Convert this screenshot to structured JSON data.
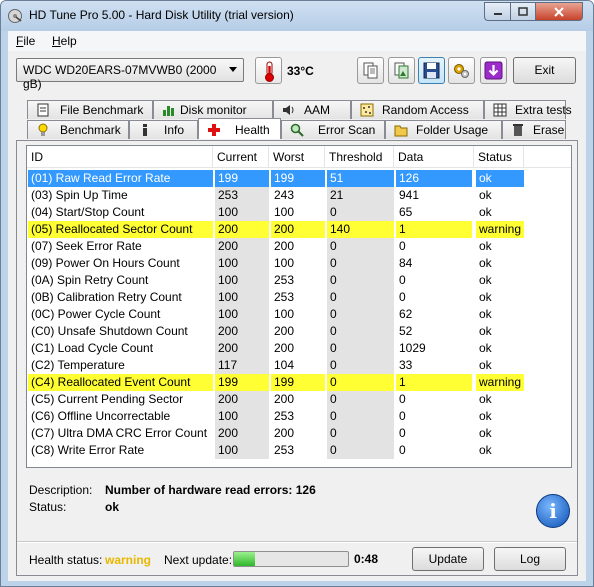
{
  "window": {
    "title": "HD Tune Pro 5.00 - Hard Disk Utility (trial version)"
  },
  "menu": {
    "file_u": "F",
    "file_rest": "ile",
    "help_u": "H",
    "help_rest": "elp"
  },
  "toolbar": {
    "drive": "WDC WD20EARS-07MVWB0 (2000 gB)",
    "temperature": "33°C",
    "exit_label": "Exit"
  },
  "tabs_top": [
    "File Benchmark",
    "Disk monitor",
    "AAM",
    "Random Access",
    "Extra tests"
  ],
  "tabs_bottom": [
    "Benchmark",
    "Info",
    "Health",
    "Error Scan",
    "Folder Usage",
    "Erase"
  ],
  "active_tab": "Health",
  "table": {
    "headers": [
      "ID",
      "Current",
      "Worst",
      "Threshold",
      "Data",
      "Status"
    ],
    "rows": [
      [
        "(01) Raw Read Error Rate",
        "199",
        "199",
        "51",
        "126",
        "ok"
      ],
      [
        "(03) Spin Up Time",
        "253",
        "243",
        "21",
        "941",
        "ok"
      ],
      [
        "(04) Start/Stop Count",
        "100",
        "100",
        "0",
        "65",
        "ok"
      ],
      [
        "(05) Reallocated Sector Count",
        "200",
        "200",
        "140",
        "1",
        "warning"
      ],
      [
        "(07) Seek Error Rate",
        "200",
        "200",
        "0",
        "0",
        "ok"
      ],
      [
        "(09) Power On Hours Count",
        "100",
        "100",
        "0",
        "84",
        "ok"
      ],
      [
        "(0A) Spin Retry Count",
        "100",
        "253",
        "0",
        "0",
        "ok"
      ],
      [
        "(0B) Calibration Retry Count",
        "100",
        "253",
        "0",
        "0",
        "ok"
      ],
      [
        "(0C) Power Cycle Count",
        "100",
        "100",
        "0",
        "62",
        "ok"
      ],
      [
        "(C0) Unsafe Shutdown Count",
        "200",
        "200",
        "0",
        "52",
        "ok"
      ],
      [
        "(C1) Load Cycle Count",
        "200",
        "200",
        "0",
        "1029",
        "ok"
      ],
      [
        "(C2) Temperature",
        "117",
        "104",
        "0",
        "33",
        "ok"
      ],
      [
        "(C4) Reallocated Event Count",
        "199",
        "199",
        "0",
        "1",
        "warning"
      ],
      [
        "(C5) Current Pending Sector",
        "200",
        "200",
        "0",
        "0",
        "ok"
      ],
      [
        "(C6) Offline Uncorrectable",
        "100",
        "253",
        "0",
        "0",
        "ok"
      ],
      [
        "(C7) Ultra DMA CRC Error Count",
        "200",
        "200",
        "0",
        "0",
        "ok"
      ],
      [
        "(C8) Write Error Rate",
        "100",
        "253",
        "0",
        "0",
        "ok"
      ]
    ],
    "selected_row": 0
  },
  "details": {
    "description_label": "Description:",
    "description_value": "Number of hardware read errors: 126",
    "status_label": "Status:",
    "status_value": "ok"
  },
  "footer": {
    "health_label": "Health status:",
    "health_value": "warning",
    "next_update_label": "Next update:",
    "progress_fraction": 0.18,
    "countdown": "0:48",
    "update_label": "Update",
    "log_label": "Log"
  },
  "colors": {
    "selected": "#3399ff",
    "warning_row": "#ffff33",
    "health_warning": "#e8b800"
  }
}
